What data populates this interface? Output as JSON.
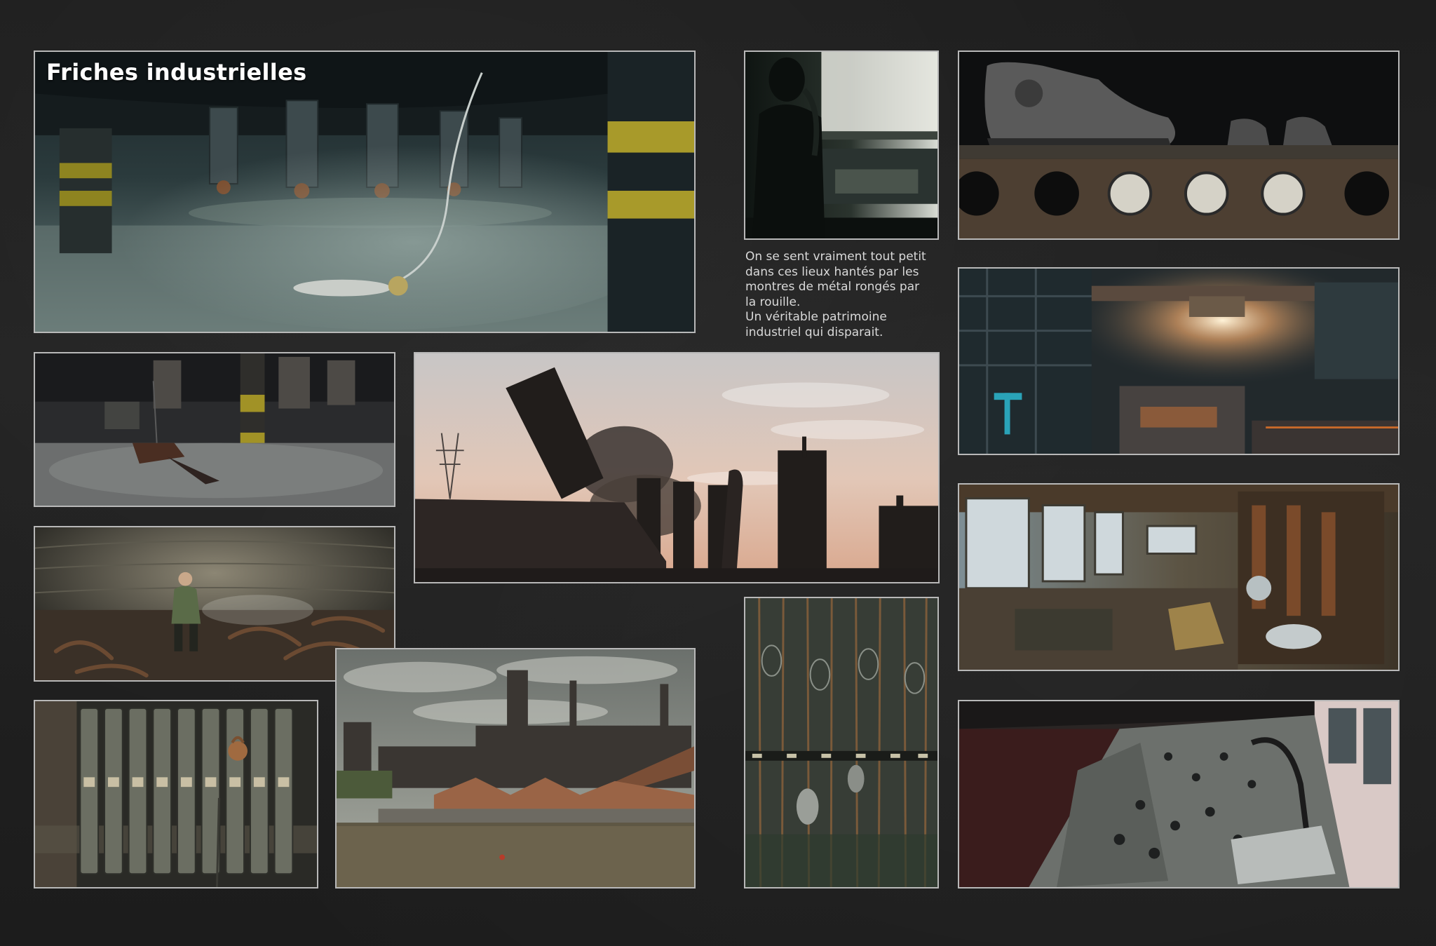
{
  "page": {
    "title": "Friches industrielles",
    "caption_lines": [
      "On se sent vraiment tout petit",
      "dans ces lieux hantés par les",
      "montres de métal rongés par",
      "la rouille.",
      "Un véritable patrimoine",
      "industriel qui disparait."
    ]
  },
  "photos": [
    {
      "id": "blast-furnace-hall",
      "content": "Hall of blast furnace tuyeres with a hazmat figure lying on the dusty floor"
    },
    {
      "id": "gas-mask-silhouette",
      "content": "Silhouette of a person wearing a gas mask by a window"
    },
    {
      "id": "boots-and-gauges",
      "content": "Old boots on a rusty shelf above round pressure gauges"
    },
    {
      "id": "steel-mill-crane",
      "content": "Steel mill interior with an overhead crane and bright backlight"
    },
    {
      "id": "furnace-floor-toy",
      "content": "Furnace floor with a toy vehicle in the dust"
    },
    {
      "id": "demolished-tower",
      "content": "Collapsing blast furnace tower with smoke at sunset, pylon in background"
    },
    {
      "id": "mechanical-hall",
      "content": "Large hall with broad windows and rusted machinery"
    },
    {
      "id": "man-in-tank",
      "content": "Man sitting inside a riveted tank among scrap metal"
    },
    {
      "id": "blast-furnace-river",
      "content": "Blast furnace plant beside a river under a cloudy sky"
    },
    {
      "id": "hanging-chains",
      "content": "Changing-room ceiling with hanging chains and baskets"
    },
    {
      "id": "control-panel",
      "content": "Control room desk with switches and a microphone"
    },
    {
      "id": "locked-levers",
      "content": "Row of metal levers with a padlock"
    }
  ],
  "colors": {
    "background": "#212121",
    "frame_border": "#b8b8b8",
    "title": "#ffffff",
    "caption": "#d9d9d9"
  }
}
